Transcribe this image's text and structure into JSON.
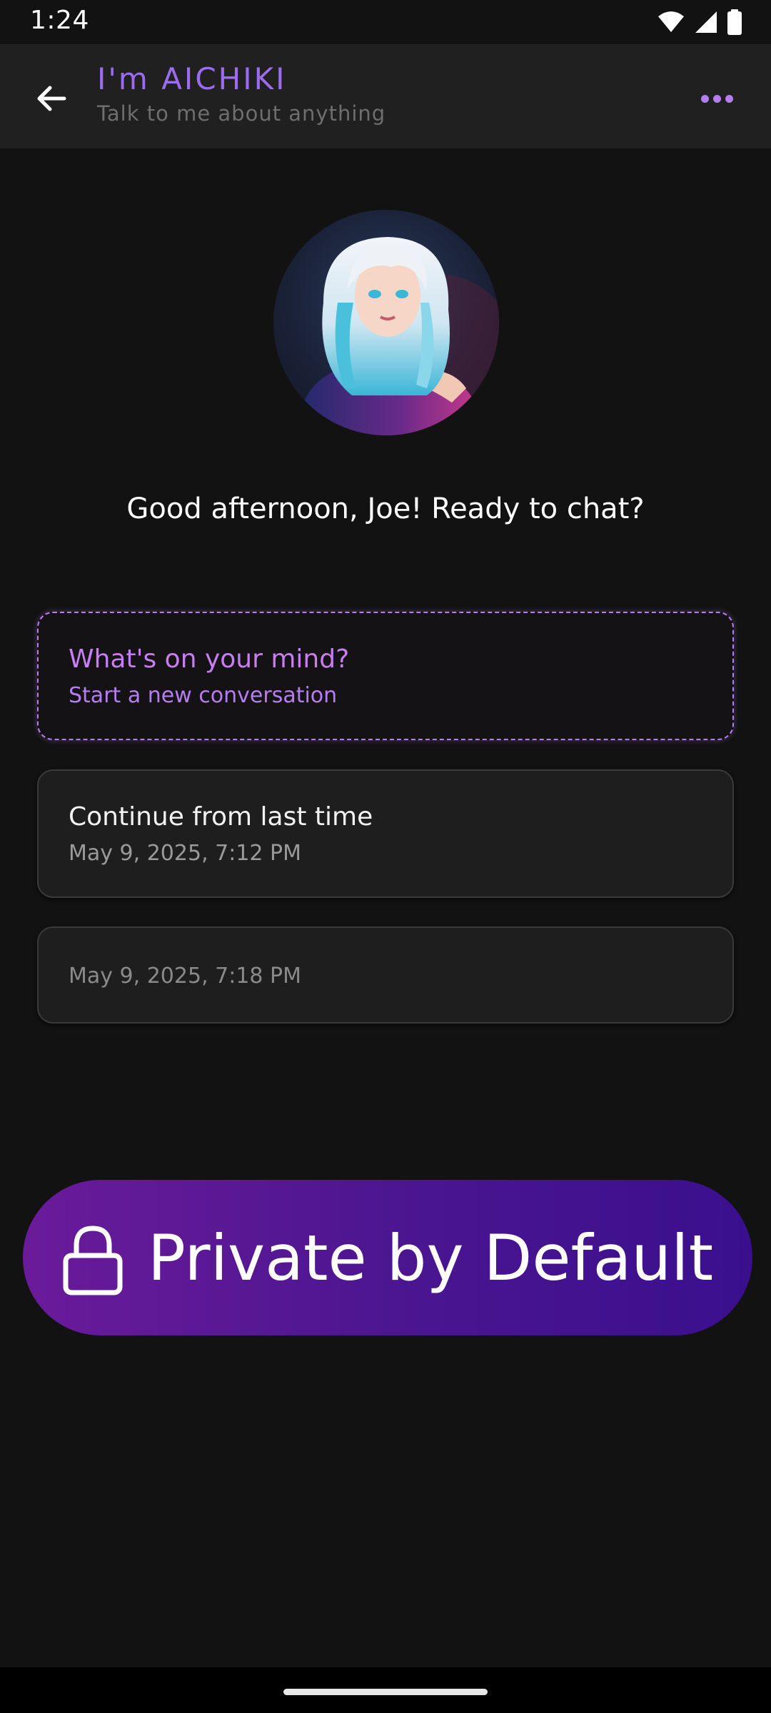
{
  "status_bar": {
    "time": "1:24",
    "icons": [
      "wifi-icon",
      "signal-icon",
      "battery-icon"
    ]
  },
  "header": {
    "title": "I'm AICHIKI",
    "subtitle": "Talk to me about anything",
    "back_icon": "arrow-left-icon",
    "menu_icon": "more-horizontal-icon"
  },
  "greeting": "Good afternoon, Joe! Ready to chat?",
  "cards": {
    "new_conversation": {
      "title": "What's on your mind?",
      "subtitle": "Start a new conversation"
    },
    "continue": {
      "title": "Continue from last time",
      "timestamp": "May 9, 2025, 7:12 PM"
    },
    "previous": {
      "timestamp": "May 9, 2025, 7:18 PM"
    }
  },
  "banner": {
    "text": "Private by Default",
    "icon": "lock-icon"
  },
  "colors": {
    "background": "#121212",
    "app_bar": "#202020",
    "accent": "#9b6cf0",
    "accent_light": "#b57ef0",
    "banner_start": "#6a1b9a",
    "banner_end": "#3a0f8e"
  }
}
